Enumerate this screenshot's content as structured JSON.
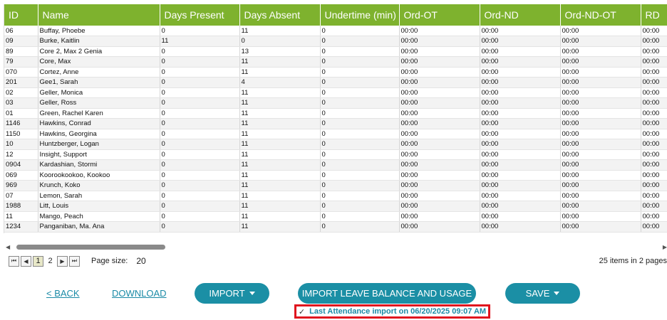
{
  "columns": [
    "ID",
    "Name",
    "Days Present",
    "Days Absent",
    "Undertime (min)",
    "Ord-OT",
    "Ord-ND",
    "Ord-ND-OT",
    "RD"
  ],
  "rows": [
    [
      "06",
      "Buffay, Phoebe",
      "0",
      "11",
      "0",
      "00:00",
      "00:00",
      "00:00",
      "00:00"
    ],
    [
      "09",
      "Burke, Kaitlin",
      "11",
      "0",
      "0",
      "00:00",
      "00:00",
      "00:00",
      "00:00"
    ],
    [
      "89",
      "Core 2, Max 2 Genia",
      "0",
      "13",
      "0",
      "00:00",
      "00:00",
      "00:00",
      "00:00"
    ],
    [
      "79",
      "Core, Max",
      "0",
      "11",
      "0",
      "00:00",
      "00:00",
      "00:00",
      "00:00"
    ],
    [
      "070",
      "Cortez, Anne",
      "0",
      "11",
      "0",
      "00:00",
      "00:00",
      "00:00",
      "00:00"
    ],
    [
      "201",
      "Gee1, Sarah",
      "0",
      "4",
      "0",
      "00:00",
      "00:00",
      "00:00",
      "00:00"
    ],
    [
      "02",
      "Geller, Monica",
      "0",
      "11",
      "0",
      "00:00",
      "00:00",
      "00:00",
      "00:00"
    ],
    [
      "03",
      "Geller, Ross",
      "0",
      "11",
      "0",
      "00:00",
      "00:00",
      "00:00",
      "00:00"
    ],
    [
      "01",
      "Green, Rachel Karen",
      "0",
      "11",
      "0",
      "00:00",
      "00:00",
      "00:00",
      "00:00"
    ],
    [
      "1146",
      "Hawkins, Conrad",
      "0",
      "11",
      "0",
      "00:00",
      "00:00",
      "00:00",
      "00:00"
    ],
    [
      "1150",
      "Hawkins, Georgina",
      "0",
      "11",
      "0",
      "00:00",
      "00:00",
      "00:00",
      "00:00"
    ],
    [
      "10",
      "Huntzberger, Logan",
      "0",
      "11",
      "0",
      "00:00",
      "00:00",
      "00:00",
      "00:00"
    ],
    [
      "12",
      "Insight, Support",
      "0",
      "11",
      "0",
      "00:00",
      "00:00",
      "00:00",
      "00:00"
    ],
    [
      "0904",
      "Kardashian, Stormi",
      "0",
      "11",
      "0",
      "00:00",
      "00:00",
      "00:00",
      "00:00"
    ],
    [
      "069",
      "Koorookookoo, Kookoo",
      "0",
      "11",
      "0",
      "00:00",
      "00:00",
      "00:00",
      "00:00"
    ],
    [
      "969",
      "Krunch, Koko",
      "0",
      "11",
      "0",
      "00:00",
      "00:00",
      "00:00",
      "00:00"
    ],
    [
      "07",
      "Lemon, Sarah",
      "0",
      "11",
      "0",
      "00:00",
      "00:00",
      "00:00",
      "00:00"
    ],
    [
      "1988",
      "Litt, Louis",
      "0",
      "11",
      "0",
      "00:00",
      "00:00",
      "00:00",
      "00:00"
    ],
    [
      "11",
      "Mango, Peach",
      "0",
      "11",
      "0",
      "00:00",
      "00:00",
      "00:00",
      "00:00"
    ],
    [
      "1234",
      "Panganiban, Ma. Ana",
      "0",
      "11",
      "0",
      "00:00",
      "00:00",
      "00:00",
      "00:00"
    ]
  ],
  "pager": {
    "pages": [
      "1",
      "2"
    ],
    "current_page": "1",
    "page_size_label": "Page size:",
    "page_size_value": "20",
    "items_info": "25 items in 2 pages"
  },
  "actions": {
    "back_label": "< BACK",
    "download_label": "DOWNLOAD",
    "import_label": "IMPORT",
    "import_leave_label": "IMPORT LEAVE BALANCE AND USAGE",
    "save_label": "SAVE"
  },
  "status": {
    "last_import": "Last Attendance import on 06/20/2025 09:07 AM"
  },
  "colors": {
    "header_bg": "#7eb22e",
    "button_bg": "#1b8fa5",
    "link_color": "#1a8aa6",
    "highlight_border": "#e0141e"
  },
  "icons": {
    "first_page": "first-page-icon",
    "prev_page": "prev-page-icon",
    "next_page": "next-page-icon",
    "last_page": "last-page-icon",
    "dropdown": "caret-down-icon",
    "check": "check-icon"
  }
}
